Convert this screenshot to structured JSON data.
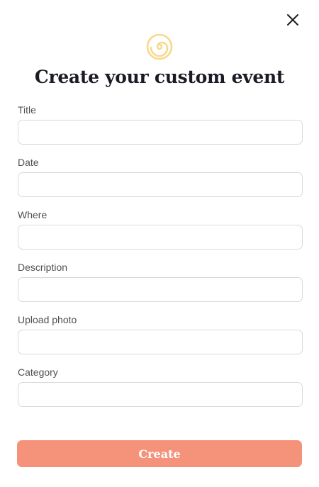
{
  "header": {
    "close_icon": "close-icon",
    "logo_icon": "spiral-logo-icon",
    "logo_color": "#f7d98e",
    "title": "Create your custom event"
  },
  "form": {
    "fields": [
      {
        "label": "Title",
        "value": "",
        "placeholder": ""
      },
      {
        "label": "Date",
        "value": "",
        "placeholder": ""
      },
      {
        "label": "Where",
        "value": "",
        "placeholder": ""
      },
      {
        "label": "Description",
        "value": "",
        "placeholder": ""
      },
      {
        "label": "Upload photo",
        "value": "",
        "placeholder": ""
      },
      {
        "label": "Category",
        "value": "",
        "placeholder": ""
      }
    ],
    "submit_label": "Create",
    "submit_color": "#f4927a"
  }
}
